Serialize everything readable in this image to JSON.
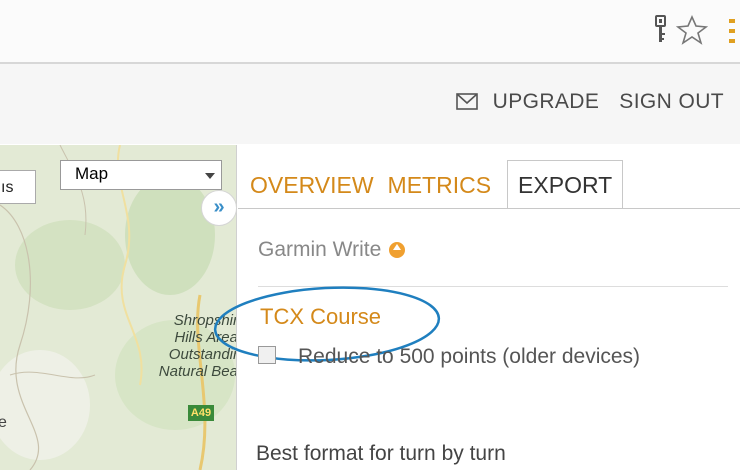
{
  "toolbar": {
    "icons": [
      "key-icon",
      "star-icon",
      "menu-icon"
    ]
  },
  "header": {
    "mail_icon": "mail-icon",
    "upgrade": "UPGRADE",
    "sign_out": "SIGN OUT"
  },
  "map": {
    "left_button": "ıs",
    "type_select": "Map",
    "label": "Shropshir\nHills Area\nOutstandir\nNatural Bea",
    "road_badge": "A49",
    "edge_label": "e"
  },
  "panel": {
    "collapse_label": "»",
    "tabs": [
      {
        "label": "OVERVIEW"
      },
      {
        "label": "METRICS"
      },
      {
        "label": "EXPORT"
      }
    ],
    "section_title": "Garmin Write",
    "tcx_link": "TCX Course",
    "reduce_label": "Reduce to 500 points (older devices)",
    "description": "Best format for turn by turn"
  },
  "colors": {
    "accent": "#d4891a",
    "annotation": "#1f7fbf"
  }
}
